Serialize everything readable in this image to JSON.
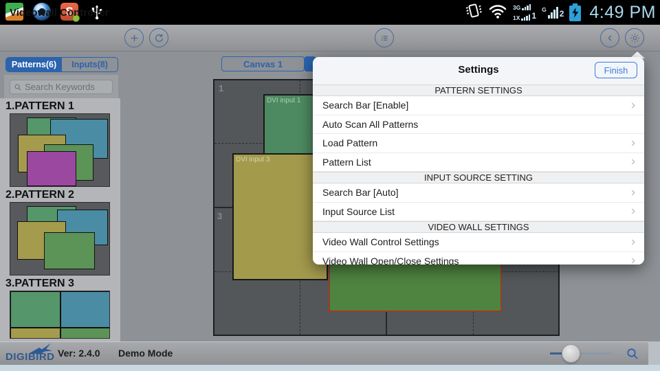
{
  "status_bar": {
    "time": "4:49 PM",
    "cdma": {
      "top": "3G",
      "bottom": "1X",
      "num": "1"
    },
    "gsm": {
      "label": "G",
      "num": "2"
    },
    "app3_letter": "S"
  },
  "header": {
    "title": "Videowall Controller"
  },
  "sidebar": {
    "tabs": [
      {
        "label": "Patterns(6)",
        "active": true
      },
      {
        "label": "Inputs(8)",
        "active": false
      }
    ],
    "search_placeholder": "Search Keywords",
    "patterns": [
      {
        "label": "1.PATTERN 1"
      },
      {
        "label": "2.PATTERN 2"
      },
      {
        "label": "3.PATTERN 3"
      }
    ]
  },
  "canvas": {
    "tab_label": "Canvas 1",
    "cell_labels": [
      "1",
      "3"
    ],
    "blocks": [
      {
        "label": "DVI input 1"
      },
      {
        "label": "DVI input 3"
      }
    ]
  },
  "settings": {
    "title": "Settings",
    "finish_label": "Finish",
    "chevron_icon": "›",
    "rows": [
      {
        "type": "section",
        "label": "PATTERN SETTINGS"
      },
      {
        "type": "item",
        "label": "Search Bar [Enable]",
        "chevron": true
      },
      {
        "type": "item",
        "label": "Auto Scan All Patterns",
        "chevron": false
      },
      {
        "type": "item",
        "label": "Load Pattern",
        "chevron": true
      },
      {
        "type": "item",
        "label": "Pattern List",
        "chevron": true
      },
      {
        "type": "section",
        "label": "INPUT SOURCE SETTING"
      },
      {
        "type": "item",
        "label": "Search Bar [Auto]",
        "chevron": true
      },
      {
        "type": "item",
        "label": "Input Source List",
        "chevron": true
      },
      {
        "type": "section",
        "label": "VIDEO WALL SETTINGS"
      },
      {
        "type": "item",
        "label": "Video Wall Control Settings",
        "chevron": true
      },
      {
        "type": "item",
        "label": "Video Wall Open/Close Settings",
        "chevron": true
      }
    ]
  },
  "footer": {
    "brand": "DIGIBIRD",
    "version": "Ver: 2.4.0",
    "mode": "Demo Mode"
  },
  "colors": {
    "accent_blue": "#2b63ad",
    "popup_blue": "#3f7cd8",
    "time_blue": "#a9d6ec",
    "canvas_bg": "#54575a",
    "window_green": "#4d8a61",
    "window_olive": "#a39a4c",
    "window_teal": "#4a8ca3",
    "window_purple": "#9b48a1",
    "selected_border": "#9c3a24"
  }
}
